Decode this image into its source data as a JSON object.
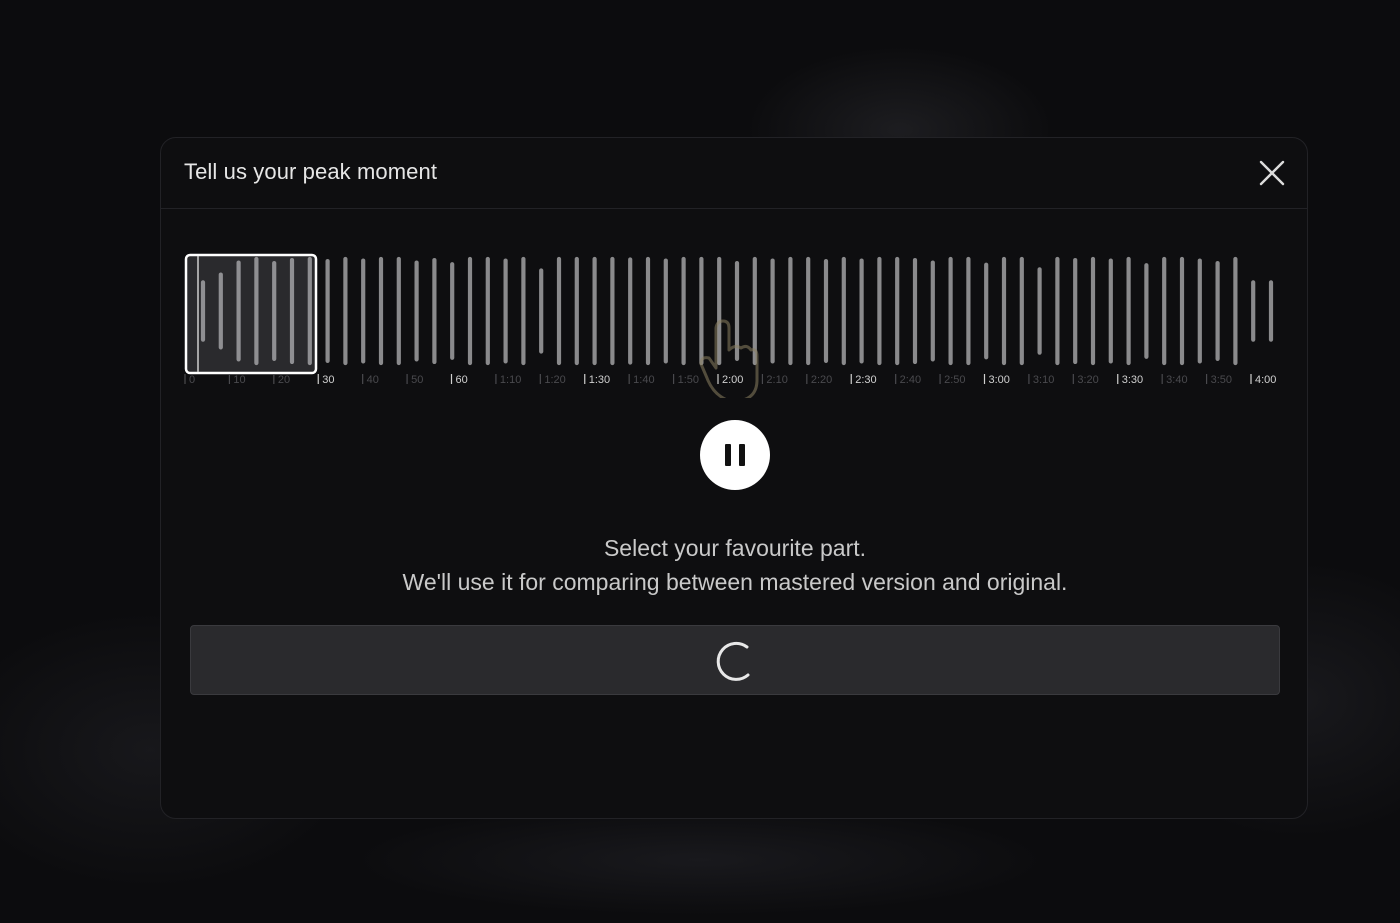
{
  "modal": {
    "title": "Tell us your peak moment",
    "close_icon": "close-icon"
  },
  "waveform": {
    "bar_levels": [
      0.55,
      0.7,
      0.93,
      1,
      0.92,
      0.98,
      1,
      0.96,
      1,
      0.97,
      1,
      1,
      0.93,
      0.98,
      0.9,
      1,
      1,
      0.97,
      1,
      0.78,
      1,
      1,
      1,
      1,
      0.99,
      1,
      0.97,
      1,
      1,
      1,
      0.92,
      1,
      0.97,
      1,
      1,
      0.96,
      1,
      0.97,
      1,
      1,
      0.98,
      0.93,
      1,
      1,
      0.89,
      1,
      1,
      0.8,
      1,
      0.98,
      1,
      0.97,
      1,
      0.88,
      1,
      1,
      0.97,
      0.92,
      1,
      0.55,
      0.55
    ],
    "time_labels": [
      {
        "t": "0",
        "major": false
      },
      {
        "t": "10",
        "major": false
      },
      {
        "t": "20",
        "major": false
      },
      {
        "t": "30",
        "major": true
      },
      {
        "t": "40",
        "major": false
      },
      {
        "t": "50",
        "major": false
      },
      {
        "t": "60",
        "major": true
      },
      {
        "t": "1:10",
        "major": false
      },
      {
        "t": "1:20",
        "major": false
      },
      {
        "t": "1:30",
        "major": true
      },
      {
        "t": "1:40",
        "major": false
      },
      {
        "t": "1:50",
        "major": false
      },
      {
        "t": "2:00",
        "major": true
      },
      {
        "t": "2:10",
        "major": false
      },
      {
        "t": "2:20",
        "major": false
      },
      {
        "t": "2:30",
        "major": true
      },
      {
        "t": "2:40",
        "major": false
      },
      {
        "t": "2:50",
        "major": false
      },
      {
        "t": "3:00",
        "major": true
      },
      {
        "t": "3:10",
        "major": false
      },
      {
        "t": "3:20",
        "major": false
      },
      {
        "t": "3:30",
        "major": true
      },
      {
        "t": "3:40",
        "major": false
      },
      {
        "t": "3:50",
        "major": false
      },
      {
        "t": "4:00",
        "major": true
      }
    ],
    "selection_handle": "selection-window"
  },
  "player": {
    "pause_icon": "pause-icon"
  },
  "instructions": {
    "line1": "Select your favourite part.",
    "line2": "We'll use it for comparing between mastered version and original."
  },
  "action": {
    "state": "loading",
    "spinner_icon": "spinner-icon"
  },
  "colors": {
    "bar": "#8a8a8c",
    "bar_selected": "#8f8f92",
    "selection_border": "#ffffff",
    "label_major": "#d0d0d0",
    "label_minor": "#4a4a4e",
    "cursor_hint": "#8a7f60"
  }
}
